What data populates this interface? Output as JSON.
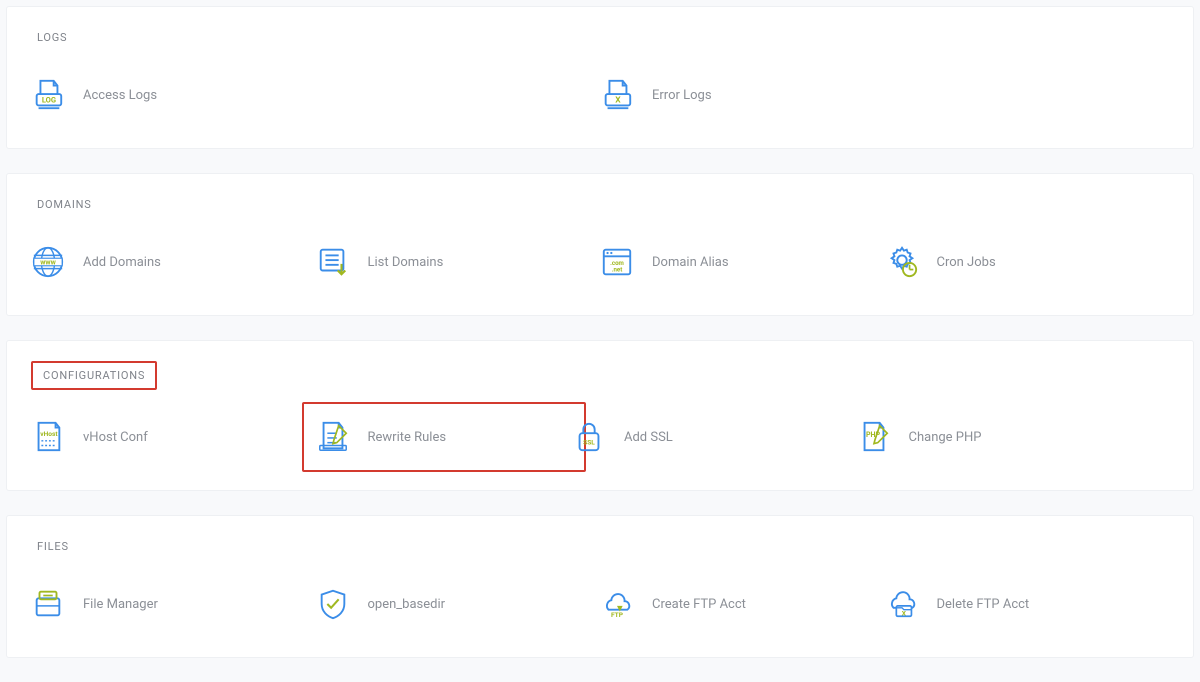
{
  "sections": {
    "logs": {
      "title": "LOGS",
      "items": {
        "access_logs": "Access Logs",
        "error_logs": "Error Logs"
      }
    },
    "domains": {
      "title": "DOMAINS",
      "items": {
        "add_domains": "Add Domains",
        "list_domains": "List Domains",
        "domain_alias": "Domain Alias",
        "cron_jobs": "Cron Jobs"
      }
    },
    "configurations": {
      "title": "CONFIGURATIONS",
      "items": {
        "vhost_conf": "vHost Conf",
        "rewrite_rules": "Rewrite Rules",
        "add_ssl": "Add SSL",
        "change_php": "Change PHP"
      }
    },
    "files": {
      "title": "FILES",
      "items": {
        "file_manager": "File Manager",
        "open_basedir": "open_basedir",
        "create_ftp": "Create FTP Acct",
        "delete_ftp": "Delete FTP Acct"
      }
    }
  },
  "icon_text": {
    "log": "LOG",
    "x": "X",
    "www": "www",
    "com_net": ".com\n.net",
    "vhost": "vHost",
    "ssl": "SSL",
    "php": "PHP",
    "ftp": "FTP"
  }
}
